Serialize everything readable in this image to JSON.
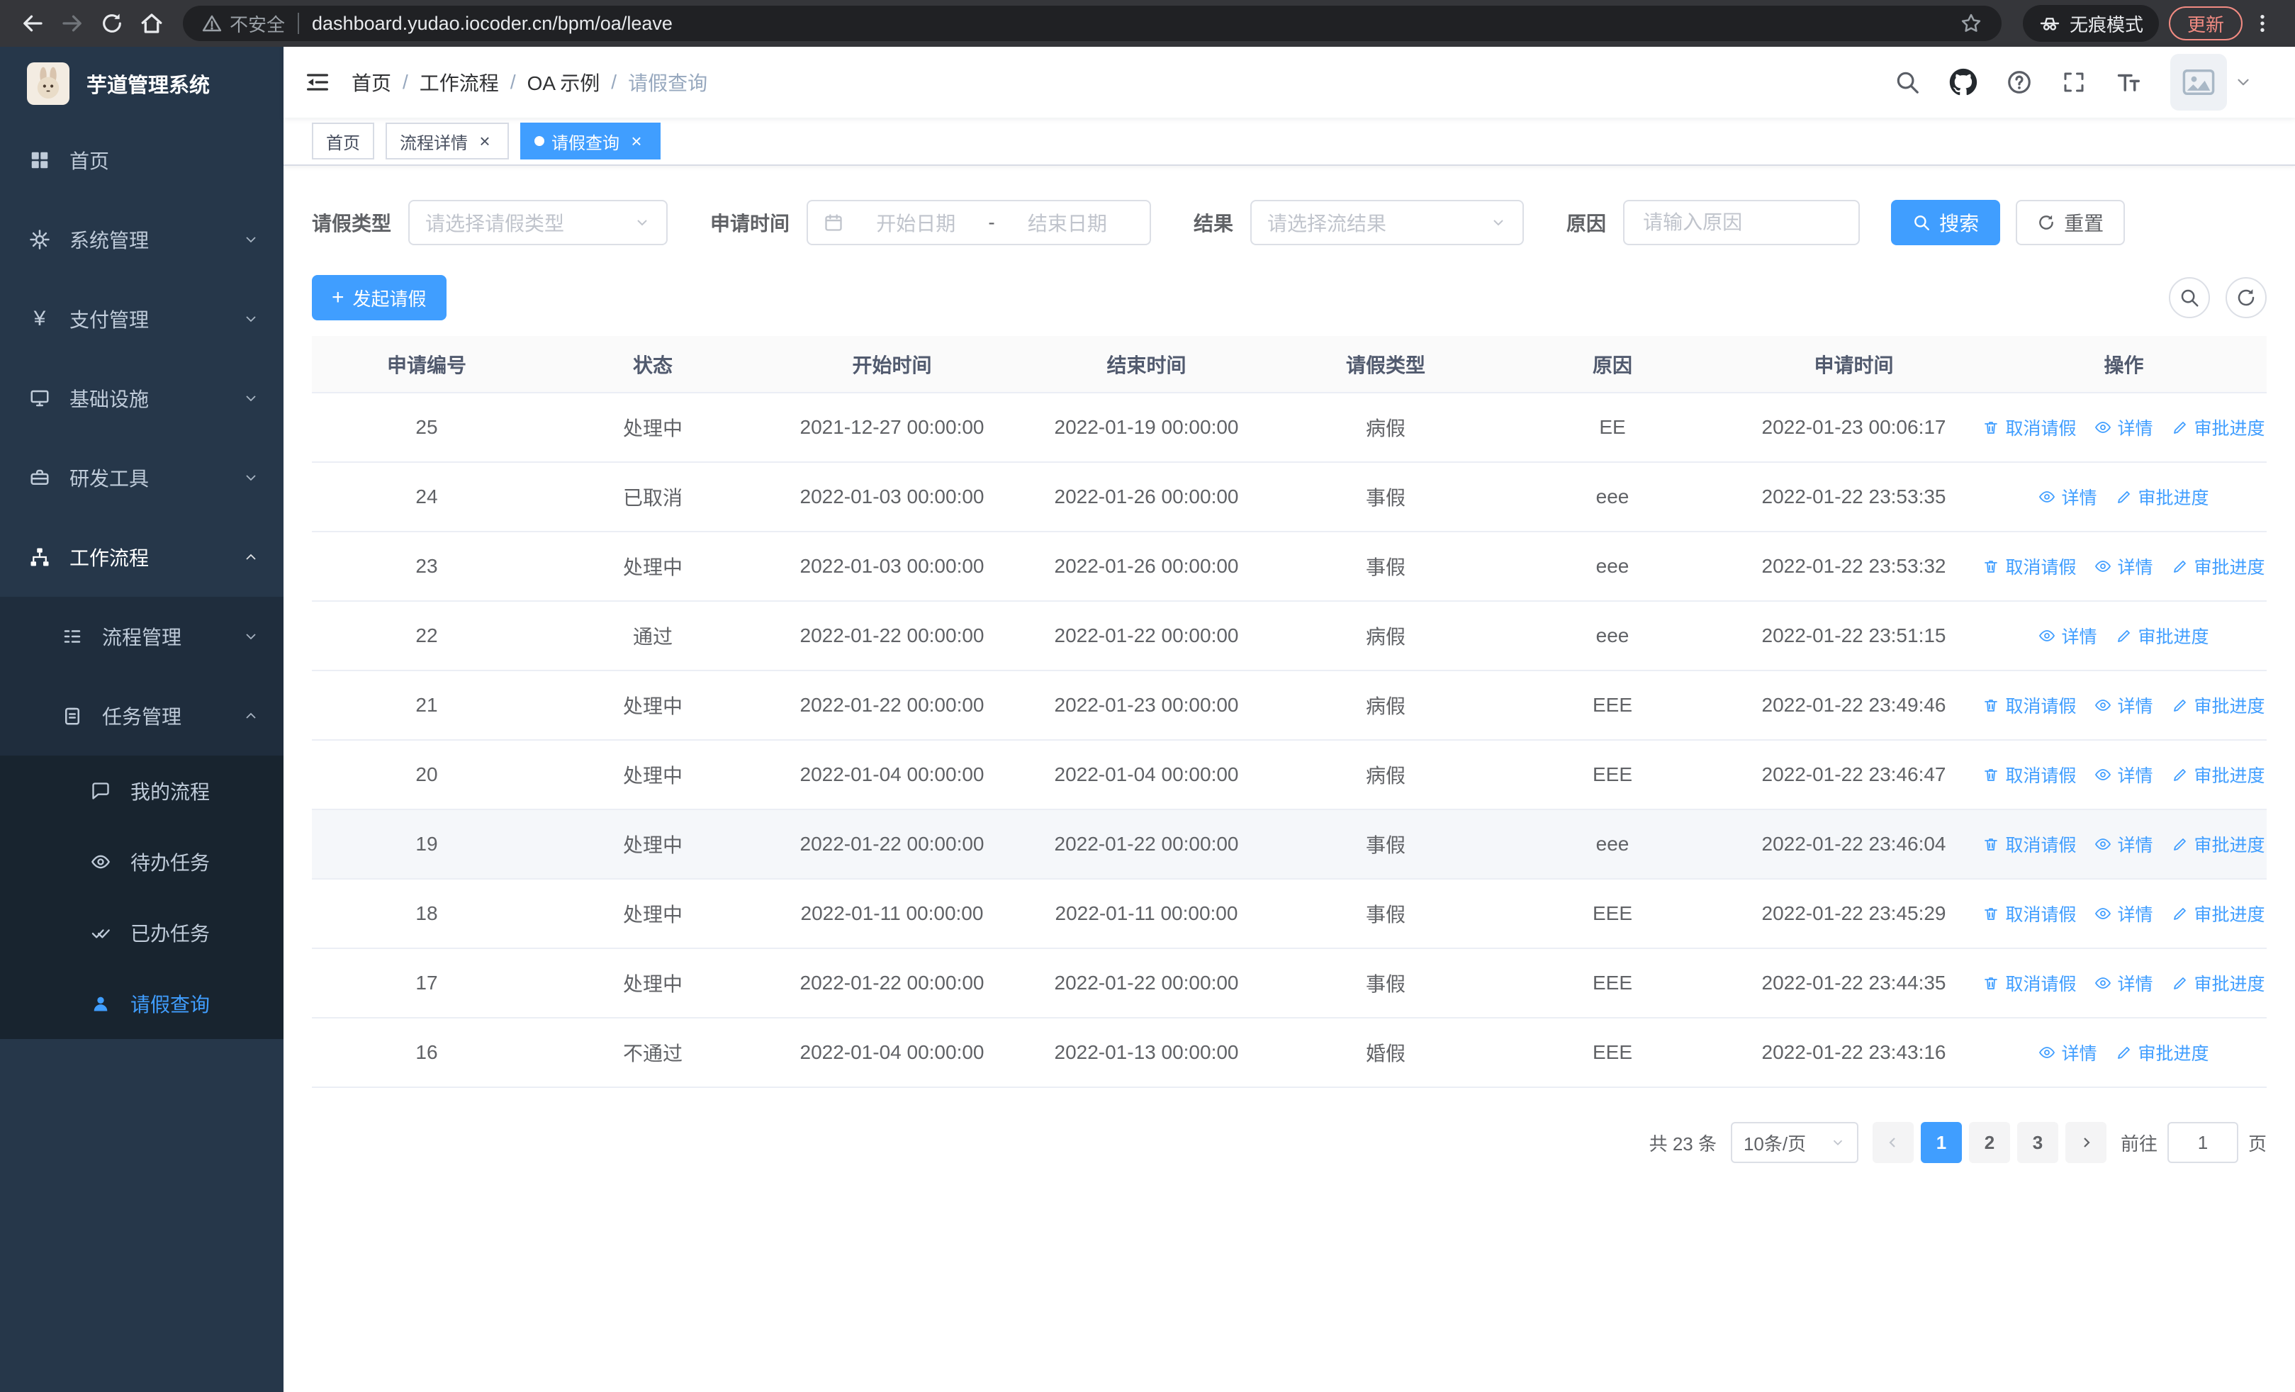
{
  "colors": {
    "primary": "#409eff",
    "sidebar_bg": "#26374a",
    "danger": "#f28b82"
  },
  "browser": {
    "security_warning": "不安全",
    "url": "dashboard.yudao.iocoder.cn/bpm/oa/leave",
    "incognito_label": "无痕模式",
    "update_label": "更新"
  },
  "sidebar": {
    "logo_title": "芋道管理系统",
    "menu": [
      "首页",
      "系统管理",
      "支付管理",
      "基础设施",
      "研发工具",
      "工作流程"
    ],
    "workflow_children": [
      "流程管理",
      "任务管理"
    ],
    "task_children": [
      "我的流程",
      "待办任务",
      "已办任务",
      "请假查询"
    ]
  },
  "header": {
    "breadcrumb": [
      "首页",
      "工作流程",
      "OA 示例",
      "请假查询"
    ]
  },
  "tabs": [
    {
      "label": "首页"
    },
    {
      "label": "流程详情"
    },
    {
      "label": "请假查询"
    }
  ],
  "filters": {
    "leave_type_label": "请假类型",
    "leave_type_placeholder": "请选择请假类型",
    "apply_time_label": "申请时间",
    "start_date_placeholder": "开始日期",
    "date_separator": "-",
    "end_date_placeholder": "结束日期",
    "result_label": "结果",
    "result_placeholder": "请选择流结果",
    "reason_label": "原因",
    "reason_placeholder": "请输入原因",
    "search_label": "搜索",
    "reset_label": "重置"
  },
  "toolbar": {
    "create_label": "发起请假"
  },
  "table": {
    "columns": [
      "申请编号",
      "状态",
      "开始时间",
      "结束时间",
      "请假类型",
      "原因",
      "申请时间",
      "操作"
    ],
    "action_labels": {
      "cancel": "取消请假",
      "detail": "详情",
      "progress": "审批进度"
    },
    "rows": [
      {
        "id": "25",
        "status": "处理中",
        "start": "2021-12-27 00:00:00",
        "end": "2022-01-19 00:00:00",
        "type": "病假",
        "reason": "EE",
        "applied": "2022-01-23 00:06:17",
        "actions": [
          "cancel",
          "detail",
          "progress"
        ]
      },
      {
        "id": "24",
        "status": "已取消",
        "start": "2022-01-03 00:00:00",
        "end": "2022-01-26 00:00:00",
        "type": "事假",
        "reason": "eee",
        "applied": "2022-01-22 23:53:35",
        "actions": [
          "detail",
          "progress"
        ]
      },
      {
        "id": "23",
        "status": "处理中",
        "start": "2022-01-03 00:00:00",
        "end": "2022-01-26 00:00:00",
        "type": "事假",
        "reason": "eee",
        "applied": "2022-01-22 23:53:32",
        "actions": [
          "cancel",
          "detail",
          "progress"
        ]
      },
      {
        "id": "22",
        "status": "通过",
        "start": "2022-01-22 00:00:00",
        "end": "2022-01-22 00:00:00",
        "type": "病假",
        "reason": "eee",
        "applied": "2022-01-22 23:51:15",
        "actions": [
          "detail",
          "progress"
        ]
      },
      {
        "id": "21",
        "status": "处理中",
        "start": "2022-01-22 00:00:00",
        "end": "2022-01-23 00:00:00",
        "type": "病假",
        "reason": "EEE",
        "applied": "2022-01-22 23:49:46",
        "actions": [
          "cancel",
          "detail",
          "progress"
        ]
      },
      {
        "id": "20",
        "status": "处理中",
        "start": "2022-01-04 00:00:00",
        "end": "2022-01-04 00:00:00",
        "type": "病假",
        "reason": "EEE",
        "applied": "2022-01-22 23:46:47",
        "actions": [
          "cancel",
          "detail",
          "progress"
        ]
      },
      {
        "id": "19",
        "status": "处理中",
        "start": "2022-01-22 00:00:00",
        "end": "2022-01-22 00:00:00",
        "type": "事假",
        "reason": "eee",
        "applied": "2022-01-22 23:46:04",
        "actions": [
          "cancel",
          "detail",
          "progress"
        ],
        "highlighted": true
      },
      {
        "id": "18",
        "status": "处理中",
        "start": "2022-01-11 00:00:00",
        "end": "2022-01-11 00:00:00",
        "type": "事假",
        "reason": "EEE",
        "applied": "2022-01-22 23:45:29",
        "actions": [
          "cancel",
          "detail",
          "progress"
        ]
      },
      {
        "id": "17",
        "status": "处理中",
        "start": "2022-01-22 00:00:00",
        "end": "2022-01-22 00:00:00",
        "type": "事假",
        "reason": "EEE",
        "applied": "2022-01-22 23:44:35",
        "actions": [
          "cancel",
          "detail",
          "progress"
        ]
      },
      {
        "id": "16",
        "status": "不通过",
        "start": "2022-01-04 00:00:00",
        "end": "2022-01-13 00:00:00",
        "type": "婚假",
        "reason": "EEE",
        "applied": "2022-01-22 23:43:16",
        "actions": [
          "detail",
          "progress"
        ]
      }
    ]
  },
  "pagination": {
    "total_text": "共 23 条",
    "page_size_text": "10条/页",
    "pages": [
      "1",
      "2",
      "3"
    ],
    "goto_prefix": "前往",
    "goto_value": "1",
    "goto_suffix": "页"
  }
}
